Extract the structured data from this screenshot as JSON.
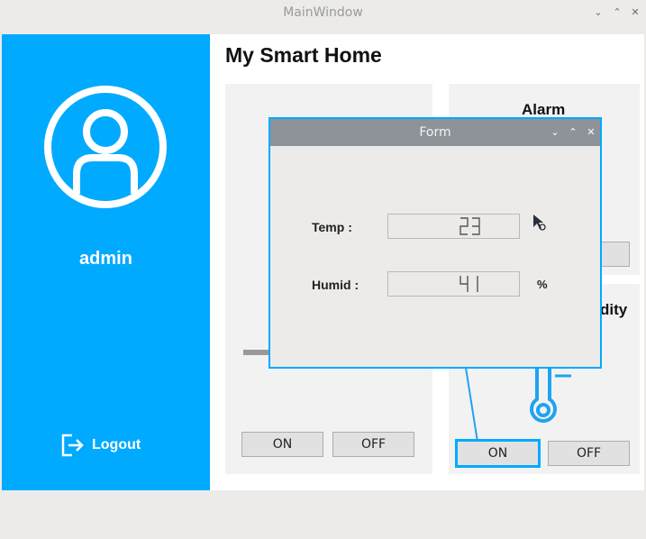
{
  "window": {
    "title": "MainWindow"
  },
  "sidebar": {
    "username": "admin",
    "logout_label": "Logout"
  },
  "main": {
    "title": "My Smart Home",
    "alarm_title": "Alarm",
    "humidity_title_partial": "dity",
    "left_panel": {
      "on_label": "ON",
      "off_label": "OFF"
    },
    "right_panel": {
      "on_label": "ON",
      "off_label": "OFF"
    }
  },
  "form": {
    "title": "Form",
    "temp_label": "Temp :",
    "temp_value": "23",
    "humid_label": "Humid :",
    "humid_value": "41",
    "humid_unit": "%"
  },
  "colors": {
    "accent": "#00aaff",
    "form_titlebar": "#8e9399",
    "background": "#ecebea"
  }
}
